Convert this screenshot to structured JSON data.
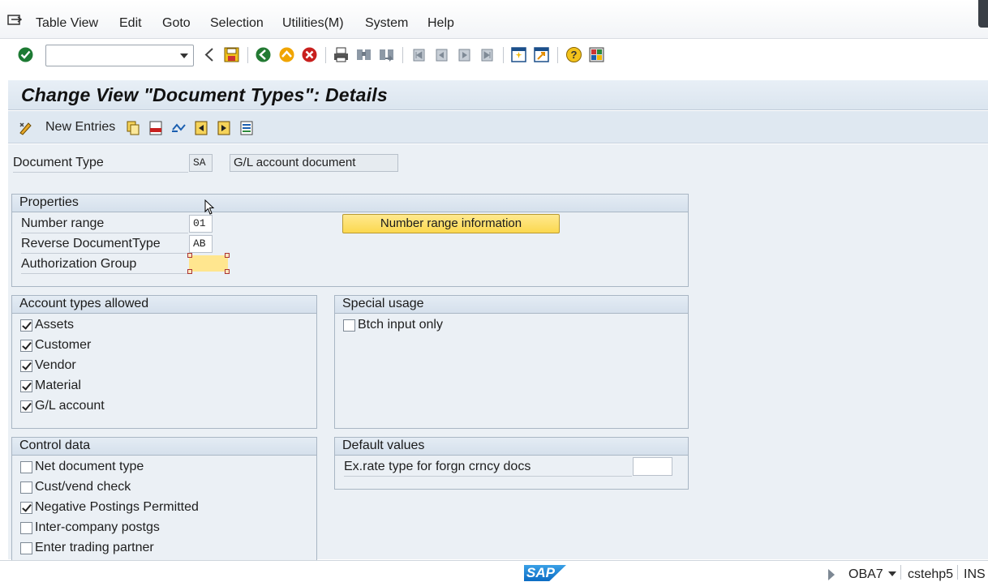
{
  "menu": {
    "items": [
      "Table View",
      "Edit",
      "Goto",
      "Selection",
      "Utilities(M)",
      "System",
      "Help"
    ]
  },
  "toolbar": {
    "command_value": "",
    "icons": [
      "enter-icon",
      "back-icon",
      "save-icon",
      "back-green-icon",
      "exit-icon",
      "cancel-icon",
      "print-icon",
      "find-icon",
      "find-next-icon",
      "first-page-icon",
      "prev-page-icon",
      "next-page-icon",
      "last-page-icon",
      "new-session-icon",
      "shortcut-icon",
      "help-icon",
      "layout-icon"
    ]
  },
  "title": "Change View \"Document Types\": Details",
  "app_toolbar": {
    "new_entries_label": "New Entries"
  },
  "header": {
    "doc_type_label": "Document Type",
    "doc_type_value": "SA",
    "doc_type_desc": "G/L account document"
  },
  "properties": {
    "title": "Properties",
    "number_range_label": "Number range",
    "number_range_value": "01",
    "reverse_label": "Reverse DocumentType",
    "reverse_value": "AB",
    "auth_label": "Authorization Group",
    "auth_value": "",
    "nr_info_button": "Number range information"
  },
  "account_types": {
    "title": "Account types allowed",
    "items": [
      {
        "label": "Assets",
        "checked": true
      },
      {
        "label": "Customer",
        "checked": true
      },
      {
        "label": "Vendor",
        "checked": true
      },
      {
        "label": "Material",
        "checked": true
      },
      {
        "label": "G/L account",
        "checked": true
      }
    ]
  },
  "special_usage": {
    "title": "Special usage",
    "items": [
      {
        "label": "Btch input only",
        "checked": false
      }
    ]
  },
  "control_data": {
    "title": "Control data",
    "items": [
      {
        "label": "Net document type",
        "checked": false
      },
      {
        "label": "Cust/vend check",
        "checked": false
      },
      {
        "label": "Negative Postings Permitted",
        "checked": true
      },
      {
        "label": "Inter-company postgs",
        "checked": false
      },
      {
        "label": "Enter trading partner",
        "checked": false
      }
    ]
  },
  "default_values": {
    "title": "Default values",
    "exrate_label": "Ex.rate type for forgn crncy docs",
    "exrate_value": ""
  },
  "status": {
    "logo": "SAP",
    "transaction": "OBA7",
    "server": "cstehp5",
    "mode": "INS"
  },
  "colors": {
    "title_bg": "#dbe5ef",
    "work_bg": "#ebf0f5",
    "button_yellow": "#fbd84f",
    "focus_yellow": "#ffe68f"
  }
}
